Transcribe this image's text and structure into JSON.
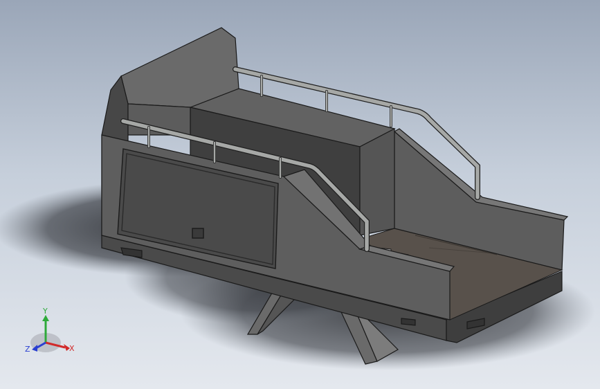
{
  "viewport": {
    "background_top": "#9aa6b8",
    "background_bottom": "#e4e8ee"
  },
  "model": {
    "body_color": "#5a5a5a",
    "edge_color": "#1a1a1a",
    "rail_color": "#a8aaa8"
  },
  "triad": {
    "x_label": "X",
    "y_label": "Y",
    "z_label": "Z",
    "x_color": "#d12a2a",
    "y_color": "#2eaa3a",
    "z_color": "#2a3fd1"
  }
}
